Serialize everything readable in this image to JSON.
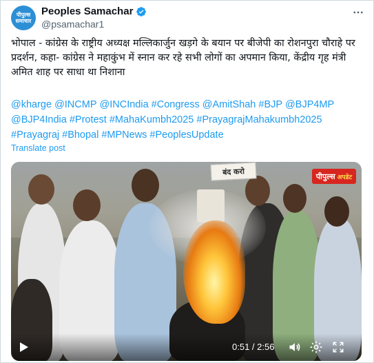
{
  "author": {
    "avatar_text": "पीपुल्स समाचार",
    "display_name": "Peoples Samachar",
    "handle": "@psamachar1",
    "verified": true
  },
  "tweet": {
    "text": "भोपाल - कांग्रेस के राष्ट्रीय अध्यक्ष मल्लिकार्जुन खड़गे के बयान पर बीजेपी का रोशनपुरा चौराहे पर प्रदर्शन, कहा- कांग्रेस ने महाकुंभ में स्नान कर रहे सभी लोगों का अपमान किया, केंद्रीय गृह मंत्री अमित शाह पर साधा था निशाना",
    "hashtags": [
      "@kharge",
      "@INCMP",
      "@INCIndia",
      "#Congress",
      "@AmitShah",
      "#BJP",
      "@BJP4MP",
      "@BJP4India",
      "#Protest",
      "#MahaKumbh2025",
      "#PrayagrajMahakumbh2025",
      "#Prayagraj",
      "#Bhopal",
      "#MPNews",
      "#PeoplesUpdate"
    ],
    "translate_label": "Translate post"
  },
  "video": {
    "placard_text": "बंद करो",
    "logo_text": "पीपुल्स",
    "logo_subtext": "अपडेट",
    "time": "0:51 / 2:56"
  },
  "colors": {
    "accent": "#1d9bf0",
    "text": "#0f1419",
    "muted": "#536471",
    "logo_red": "#d7261f"
  },
  "icons": {
    "verified": "verified-badge-icon",
    "more": "more-icon",
    "play": "play-icon",
    "volume": "volume-icon",
    "settings": "settings-icon",
    "fullscreen": "fullscreen-icon"
  }
}
